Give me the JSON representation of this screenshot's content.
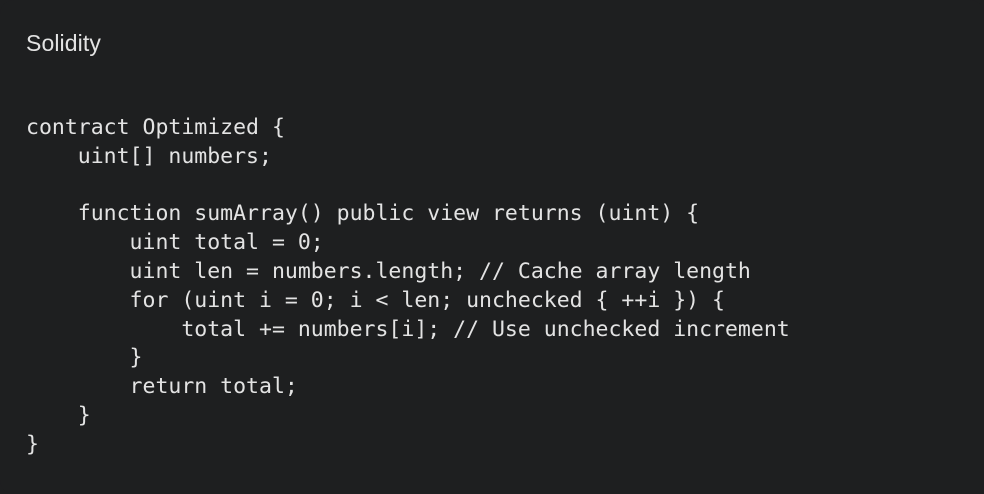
{
  "code_block": {
    "language": "Solidity",
    "lines": [
      "contract Optimized {",
      "    uint[] numbers;",
      "",
      "    function sumArray() public view returns (uint) {",
      "        uint total = 0;",
      "        uint len = numbers.length; // Cache array length",
      "        for (uint i = 0; i < len; unchecked { ++i }) {",
      "            total += numbers[i]; // Use unchecked increment",
      "        }",
      "        return total;",
      "    }",
      "}"
    ]
  },
  "colors": {
    "background": "#1e1f20",
    "text": "#e3e3e3"
  }
}
